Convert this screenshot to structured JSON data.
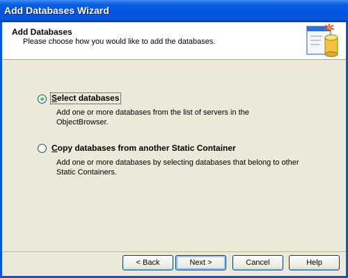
{
  "window": {
    "title": "Add Databases Wizard"
  },
  "header": {
    "title": "Add Databases",
    "subtitle": "Please choose how you would like to add the databases.",
    "graphic_icon": "database-sparkle-icon"
  },
  "options": [
    {
      "label_underline": "S",
      "label_rest": "elect databases",
      "description_line1": "Add one or more databases from the list of servers in the",
      "description_line2": "ObjectBrowser.",
      "selected": true
    },
    {
      "label_underline": "C",
      "label_rest": "opy databases from another Static Container",
      "description_line1": "Add one or more databases by selecting databases that belong to other",
      "description_line2": "Static Containers.",
      "selected": false
    }
  ],
  "buttons": {
    "back": "< Back",
    "next": "Next >",
    "cancel": "Cancel",
    "help": "Help"
  },
  "colors": {
    "titlebar": "#0054e3",
    "dialog_bg": "#ece9d8",
    "header_bg": "#ffffff",
    "radio_selected": "#21a121"
  }
}
